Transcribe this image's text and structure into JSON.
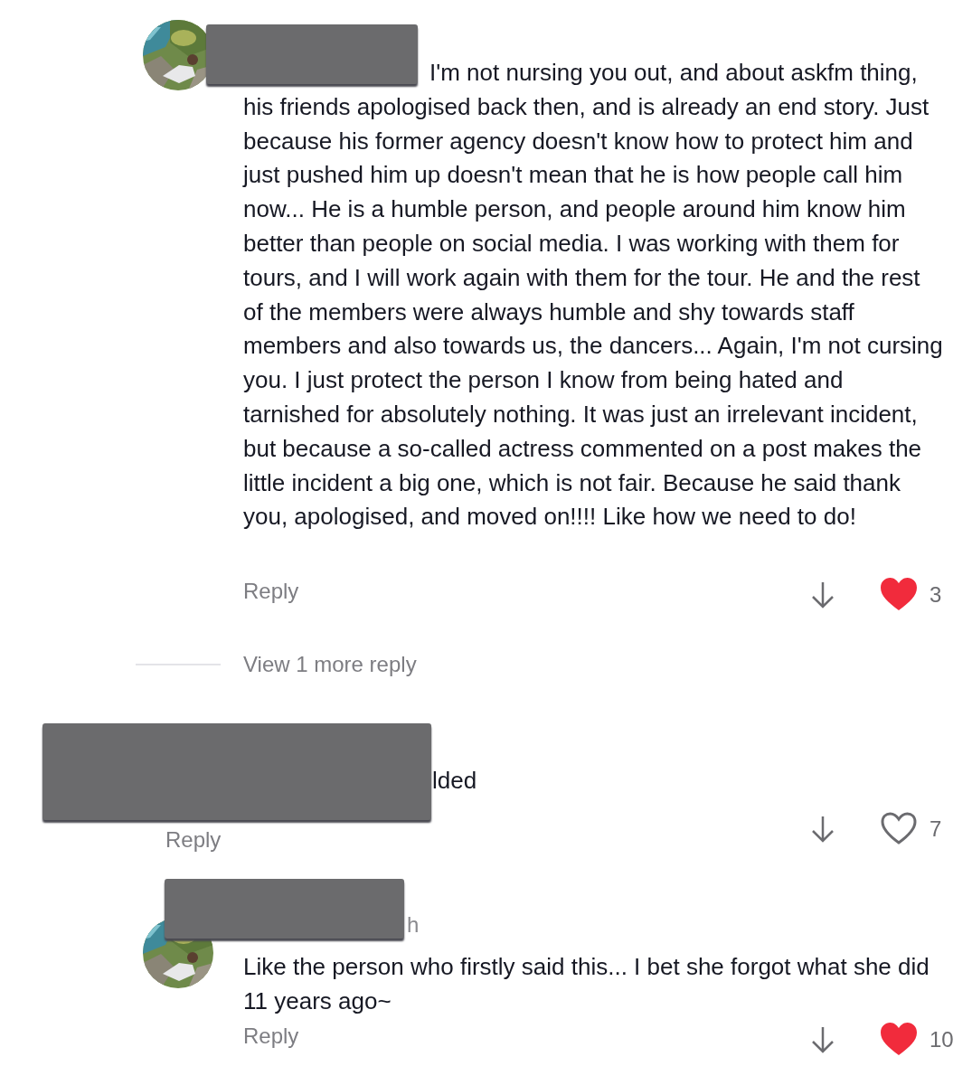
{
  "comments": [
    {
      "kind": "reply",
      "body": "I'm not nursing you out, and about askfm thing, his friends apologised back then, and is already an end story. Just because his former agency doesn't know how to protect him and just pushed him up doesn't mean that he is how people call him now... He is a humble person, and people around him know him better than people on social media. I was working with them for tours, and I will work again with them for the tour. He and the rest of the members were always humble and shy towards staff members and also towards us, the dancers... Again, I'm not cursing you. I just protect the person I know from being hated and tarnished for absolutely nothing. It was just an irrelevant incident, but because a so-called actress commented on a post makes the little incident a big one, which is not fair. Because he said thank you, apologised, and moved on!!!! Like how we need to do!",
      "reply_label": "Reply",
      "liked": true,
      "likes": "3",
      "view_more": "View 1 more reply"
    },
    {
      "kind": "top",
      "body": "lded",
      "reply_label": "Reply",
      "liked": false,
      "likes": "7"
    },
    {
      "kind": "reply",
      "time": "h",
      "body": "Like the person who firstly said this... I bet she forgot what she did 11 years ago~",
      "reply_label": "Reply",
      "liked": true,
      "likes": "10"
    }
  ]
}
